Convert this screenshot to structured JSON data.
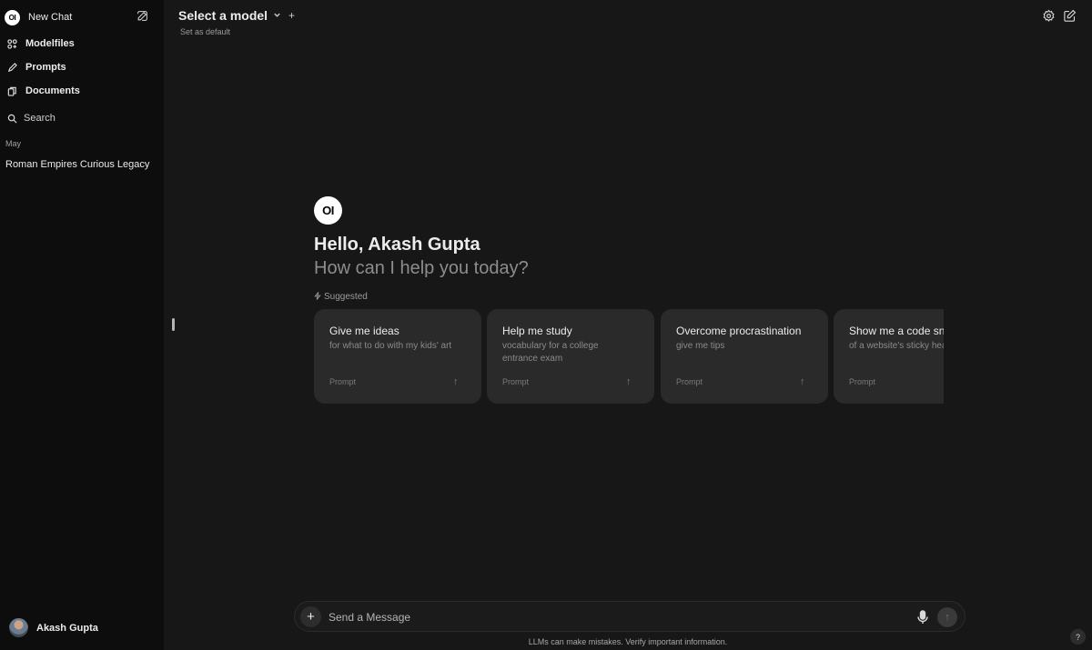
{
  "sidebar": {
    "logo": "OI",
    "new_chat": "New Chat",
    "items": [
      {
        "label": "Modelfiles",
        "icon": "modelfiles-icon"
      },
      {
        "label": "Prompts",
        "icon": "pencil-icon"
      },
      {
        "label": "Documents",
        "icon": "documents-icon"
      }
    ],
    "search_label": "Search",
    "month": "May",
    "chats": [
      "Roman Empires Curious Legacy"
    ],
    "user_name": "Akash Gupta"
  },
  "header": {
    "model_title": "Select a model",
    "chevron": "⌄",
    "add": "+",
    "set_default": "Set as default"
  },
  "main": {
    "logo": "OI",
    "greeting": "Hello, Akash Gupta",
    "subgreeting": "How can I help you today?",
    "suggested_label": "Suggested",
    "cards": [
      {
        "title": "Give me ideas",
        "subtitle": "for what to do with my kids' art",
        "tag": "Prompt",
        "arrow": "↑"
      },
      {
        "title": "Help me study",
        "subtitle": "vocabulary for a college entrance exam",
        "tag": "Prompt",
        "arrow": "↑"
      },
      {
        "title": "Overcome procrastination",
        "subtitle": "give me tips",
        "tag": "Prompt",
        "arrow": "↑"
      },
      {
        "title": "Show me a code snippet",
        "subtitle": "of a website's sticky header",
        "tag": "Prompt",
        "arrow": "↑"
      }
    ]
  },
  "composer": {
    "plus": "+",
    "placeholder": "Send a Message",
    "send": "↑"
  },
  "footer": {
    "disclaimer": "LLMs can make mistakes. Verify important information.",
    "help": "?"
  }
}
